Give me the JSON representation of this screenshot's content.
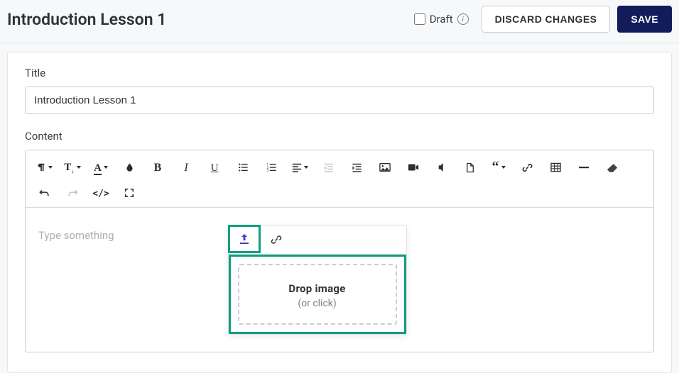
{
  "header": {
    "title": "Introduction Lesson 1",
    "draft_label": "Draft",
    "discard_label": "Discard Changes",
    "save_label": "Save"
  },
  "form": {
    "title_label": "Title",
    "title_value": "Introduction Lesson 1",
    "content_label": "Content",
    "editor_placeholder": "Type something"
  },
  "toolbar": {
    "row1": [
      {
        "name": "paragraph-format",
        "icon": "pilcrow",
        "caret": true
      },
      {
        "name": "font-size",
        "icon": "T-sub",
        "caret": true
      },
      {
        "name": "font-color",
        "icon": "A-underline",
        "caret": true
      },
      {
        "name": "text-highlight",
        "icon": "drop"
      },
      {
        "name": "bold",
        "icon": "bold"
      },
      {
        "name": "italic",
        "icon": "italic"
      },
      {
        "name": "underline",
        "icon": "underline"
      },
      {
        "name": "unordered-list",
        "icon": "ul"
      },
      {
        "name": "ordered-list",
        "icon": "ol"
      },
      {
        "name": "align",
        "icon": "align-left",
        "caret": true
      },
      {
        "name": "outdent",
        "icon": "outdent",
        "disabled": true
      },
      {
        "name": "indent",
        "icon": "indent"
      },
      {
        "name": "insert-image",
        "icon": "image"
      },
      {
        "name": "insert-video",
        "icon": "video"
      },
      {
        "name": "insert-audio",
        "icon": "audio"
      },
      {
        "name": "insert-file",
        "icon": "file"
      },
      {
        "name": "quote",
        "icon": "quote",
        "caret": true
      },
      {
        "name": "insert-link",
        "icon": "link"
      },
      {
        "name": "insert-table",
        "icon": "table"
      },
      {
        "name": "horizontal-rule",
        "icon": "hr"
      },
      {
        "name": "clear-formatting",
        "icon": "eraser"
      }
    ],
    "row2": [
      {
        "name": "undo",
        "icon": "undo"
      },
      {
        "name": "redo",
        "icon": "redo",
        "disabled": true
      },
      {
        "name": "code-view",
        "icon": "code"
      },
      {
        "name": "fullscreen",
        "icon": "expand"
      }
    ]
  },
  "image_popover": {
    "tabs": {
      "upload": "upload",
      "byurl": "link"
    },
    "drop_strong": "Drop image",
    "drop_sub": "(or click)"
  }
}
